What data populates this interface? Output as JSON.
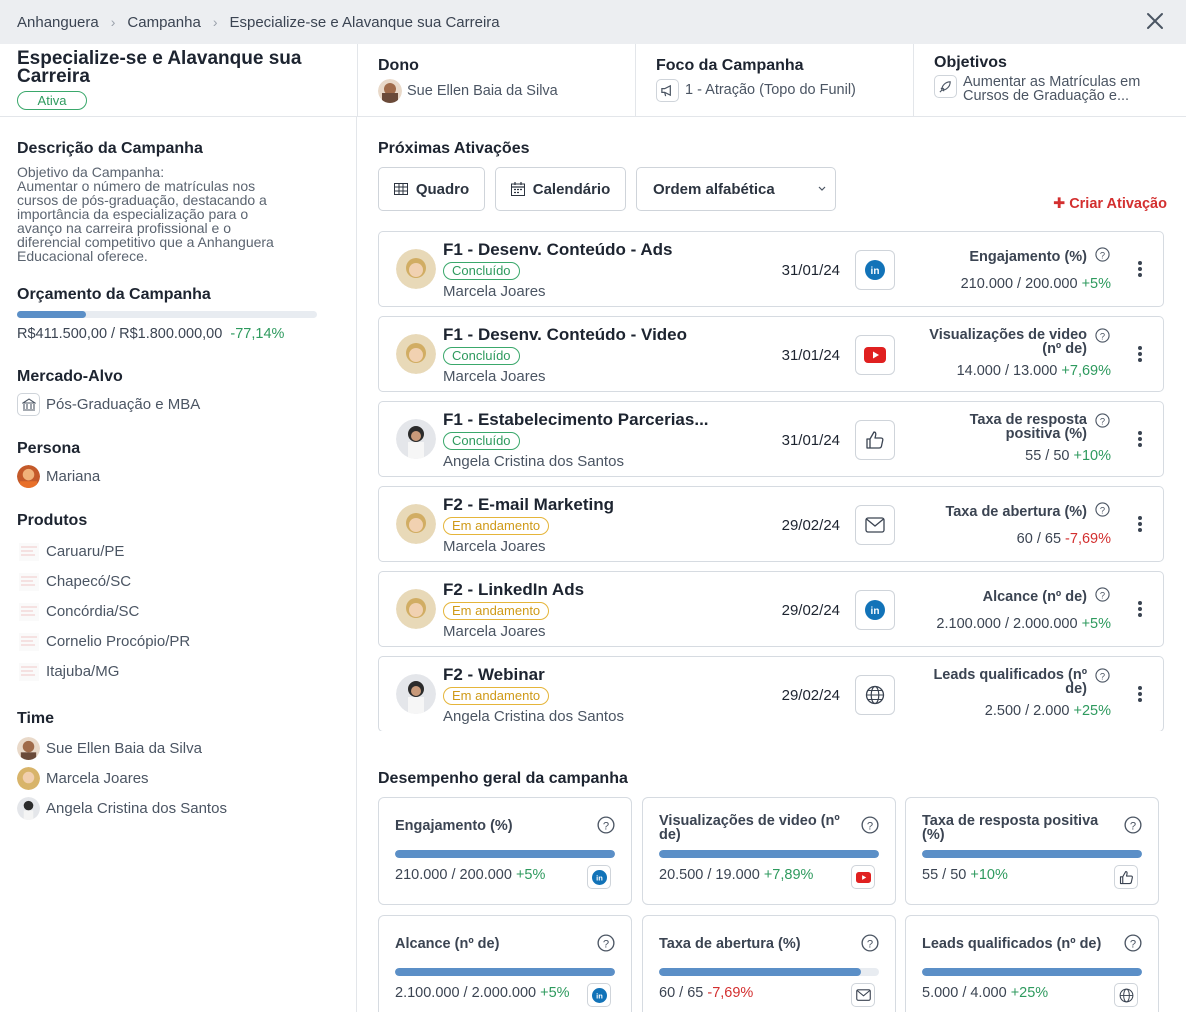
{
  "breadcrumb": [
    "Anhanguera",
    "Campanha",
    "Especialize-se e Alavanque sua Carreira"
  ],
  "campaign": {
    "title": "Especialize-se e Alavanque sua Carreira",
    "status": "Ativa"
  },
  "header": {
    "owner_title": "Dono",
    "owner_name": "Sue Ellen Baia da Silva",
    "focus_title": "Foco da Campanha",
    "focus_value": "1 - Atração (Topo do Funil)",
    "goals_title": "Objetivos",
    "goals_value_1": "Aumentar as Matrículas em",
    "goals_value_2": "Cursos de Graduação e..."
  },
  "sidebar": {
    "desc_title": "Descrição da Campanha",
    "desc_lines": [
      "Objetivo da Campanha:",
      "Aumentar o número de matrículas nos",
      "cursos de pós-graduação, destacando a",
      "importância da especialização para o",
      "avanço na carreira profissional e o",
      "diferencial competitivo que a Anhanguera",
      "Educacional oferece."
    ],
    "budget_title": "Orçamento da Campanha",
    "budget_value": "R$411.500,00 / R$1.800.000,00",
    "budget_change": "-77,14%",
    "budget_fraction": 0.2286,
    "market_title": "Mercado-Alvo",
    "market_value": "Pós-Graduação e MBA",
    "persona_title": "Persona",
    "persona_value": "Mariana",
    "products_title": "Produtos",
    "products": [
      "Caruaru/PE",
      "Chapecó/SC",
      "Concórdia/SC",
      "Cornelio Procópio/PR",
      "Itajuba/MG"
    ],
    "team_title": "Time",
    "team": [
      "Sue Ellen Baia da Silva",
      "Marcela Joares",
      "Angela Cristina dos Santos"
    ]
  },
  "activations": {
    "title": "Próximas Ativações",
    "btn_board": "Quadro",
    "btn_calendar": "Calendário",
    "sort_value": "Ordem alfabética",
    "create_label": "Criar Ativação",
    "items": [
      {
        "title": "F1 - Desenv. Conteúdo - Ads",
        "status": "Concluído",
        "owner": "Marcela Joares",
        "date": "31/01/24",
        "channel": "linkedin-icon",
        "metric_1": "Engajamento (%)",
        "metric_2": "",
        "value": "210.000 / 200.000",
        "change": "+5%"
      },
      {
        "title": "F1 - Desenv. Conteúdo - Video",
        "status": "Concluído",
        "owner": "Marcela Joares",
        "date": "31/01/24",
        "channel": "youtube-icon",
        "metric_1": "Visualizações de video",
        "metric_2": "(nº de)",
        "value": "14.000 / 13.000",
        "change": "+7,69%"
      },
      {
        "title": "F1 - Estabelecimento Parcerias...",
        "status": "Concluído",
        "owner": "Angela Cristina dos Santos",
        "date": "31/01/24",
        "channel": "thumbs-up-icon",
        "metric_1": "Taxa de resposta",
        "metric_2": "positiva (%)",
        "value": "55 / 50",
        "change": "+10%"
      },
      {
        "title": "F2 - E-mail Marketing",
        "status": "Em andamento",
        "owner": "Marcela Joares",
        "date": "29/02/24",
        "channel": "mail-icon",
        "metric_1": "Taxa de abertura (%)",
        "metric_2": "",
        "value": "60 / 65",
        "change": "-7,69%"
      },
      {
        "title": "F2 - LinkedIn Ads",
        "status": "Em andamento",
        "owner": "Marcela Joares",
        "date": "29/02/24",
        "channel": "linkedin-icon",
        "metric_1": "Alcance (nº de)",
        "metric_2": "",
        "value": "2.100.000 / 2.000.000",
        "change": "+5%"
      },
      {
        "title": "F2 - Webinar",
        "status": "Em andamento",
        "owner": "Angela Cristina dos Santos",
        "date": "29/02/24",
        "channel": "globe-icon",
        "metric_1": "Leads qualificados (nº",
        "metric_2": "de)",
        "value": "2.500 / 2.000",
        "change": "+25%"
      }
    ]
  },
  "performance": {
    "title": "Desempenho geral da campanha",
    "items": [
      {
        "label_1": "Engajamento (%)",
        "label_2": "",
        "value": "210.000 / 200.000",
        "change": "+5%",
        "fraction": 1.0,
        "icon": "linkedin-icon"
      },
      {
        "label_1": "Visualizações de video (nº",
        "label_2": "de)",
        "value": "20.500 / 19.000",
        "change": "+7,89%",
        "fraction": 1.0,
        "icon": "youtube-icon"
      },
      {
        "label_1": "Taxa de resposta positiva",
        "label_2": "(%)",
        "value": "55 / 50",
        "change": "+10%",
        "fraction": 1.0,
        "icon": "thumbs-up-icon"
      },
      {
        "label_1": "Alcance (nº de)",
        "label_2": "",
        "value": "2.100.000 / 2.000.000",
        "change": "+5%",
        "fraction": 1.0,
        "icon": "linkedin-icon"
      },
      {
        "label_1": "Taxa de abertura (%)",
        "label_2": "",
        "value": "60 / 65",
        "change": "-7,69%",
        "fraction": 0.923,
        "icon": "mail-icon"
      },
      {
        "label_1": "Leads qualificados (nº de)",
        "label_2": "",
        "value": "5.000 / 4.000",
        "change": "+25%",
        "fraction": 1.0,
        "icon": "globe-icon"
      }
    ]
  },
  "colors": {
    "accent": "#5b8fc7",
    "positive": "#2e9a5e",
    "negative": "#d32f2f",
    "in_progress": "#e5b53a"
  }
}
